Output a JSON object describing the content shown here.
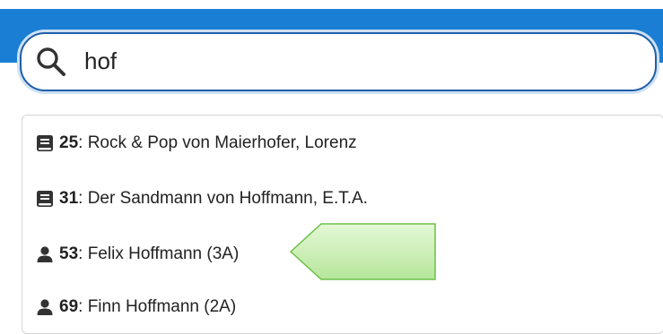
{
  "search": {
    "value": "hof",
    "placeholder": ""
  },
  "results": [
    {
      "icon": "book-icon",
      "number": "25",
      "text": ": Rock & Pop von Maierhofer, Lorenz"
    },
    {
      "icon": "book-icon",
      "number": "31",
      "text": ": Der Sandmann von Hoffmann, E.T.A."
    },
    {
      "icon": "person-icon",
      "number": "53",
      "text": ": Felix Hoffmann (3A)"
    },
    {
      "icon": "person-icon",
      "number": "69",
      "text": ": Finn Hoffmann (2A)"
    }
  ],
  "colors": {
    "header": "#1a7fd4",
    "search_border": "#1f5fa8",
    "callout_fill": "#c6efb0",
    "callout_stroke": "#6cbf4a"
  }
}
